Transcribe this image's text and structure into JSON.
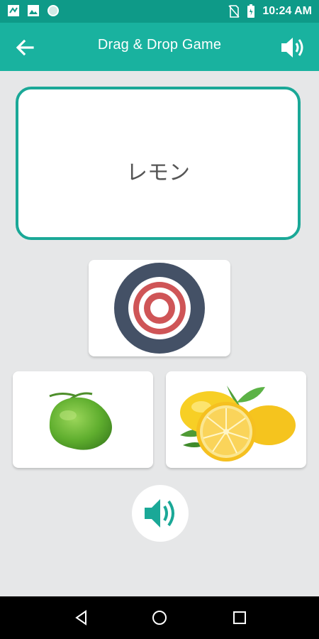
{
  "status_bar": {
    "time": "10:24 AM",
    "icons": [
      "notification-icon",
      "image-icon",
      "sync-icon",
      "no-sim-icon",
      "battery-icon"
    ]
  },
  "app_bar": {
    "title": "Drag & Drop Game",
    "back_icon": "arrow-left-icon",
    "sound_icon": "speaker-icon"
  },
  "word_card": {
    "word": "レモン"
  },
  "drop_target": {
    "icon": "target-icon"
  },
  "options": [
    {
      "image": "coconut-image"
    },
    {
      "image": "lemon-image"
    }
  ],
  "audio_button": {
    "icon": "speaker-icon"
  },
  "nav_bar": {
    "buttons": [
      "back-triangle-icon",
      "home-circle-icon",
      "recents-square-icon"
    ]
  },
  "colors": {
    "status_bar": "#0e9a88",
    "app_bar": "#19b29f",
    "accent": "#1aa897",
    "background": "#e6e7e8",
    "target_outer": "#445166",
    "target_red": "#cf5557"
  }
}
